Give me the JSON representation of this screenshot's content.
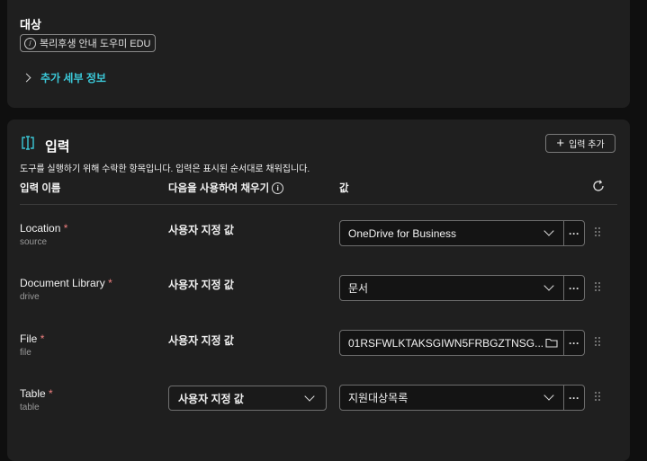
{
  "target": {
    "label": "대상",
    "chip_text": "복리후생 안내 도우미 EDU",
    "more_details_label": "추가 세부 정보"
  },
  "inputs": {
    "title": "입력",
    "add_button_label": "입력 추가",
    "description": "도구를 실행하기 위해 수락한 항목입니다. 입력은 표시된 순서대로 채워집니다.",
    "columns": {
      "name": "입력 이름",
      "fill_with": "다음을 사용하여 채우기",
      "value": "값"
    },
    "rows": [
      {
        "name": "Location",
        "required_mark": "*",
        "sub": "source",
        "fill": "사용자 지정 값",
        "value": "OneDrive for Business"
      },
      {
        "name": "Document Library",
        "required_mark": "*",
        "sub": "drive",
        "fill": "사용자 지정 값",
        "value": "문서"
      },
      {
        "name": "File",
        "required_mark": "*",
        "sub": "file",
        "fill": "사용자 지정 값",
        "value": "01RSFWLKTAKSGIWN5FRBGZTNSG..."
      },
      {
        "name": "Table",
        "required_mark": "*",
        "sub": "table",
        "fill": "사용자 지정 값",
        "value": "지원대상목록"
      }
    ],
    "more_button_text": "···"
  },
  "colors": {
    "background": "#0f0f0f",
    "card": "#1f1f1f",
    "accent_link": "#3bc8d8",
    "required": "#f08080"
  },
  "icons": [
    "info-icon",
    "input-section-icon",
    "refresh-icon",
    "chevron-right-icon",
    "chevron-down-icon",
    "folder-icon",
    "more-icon",
    "drag-handle-icon",
    "plus-icon"
  ]
}
